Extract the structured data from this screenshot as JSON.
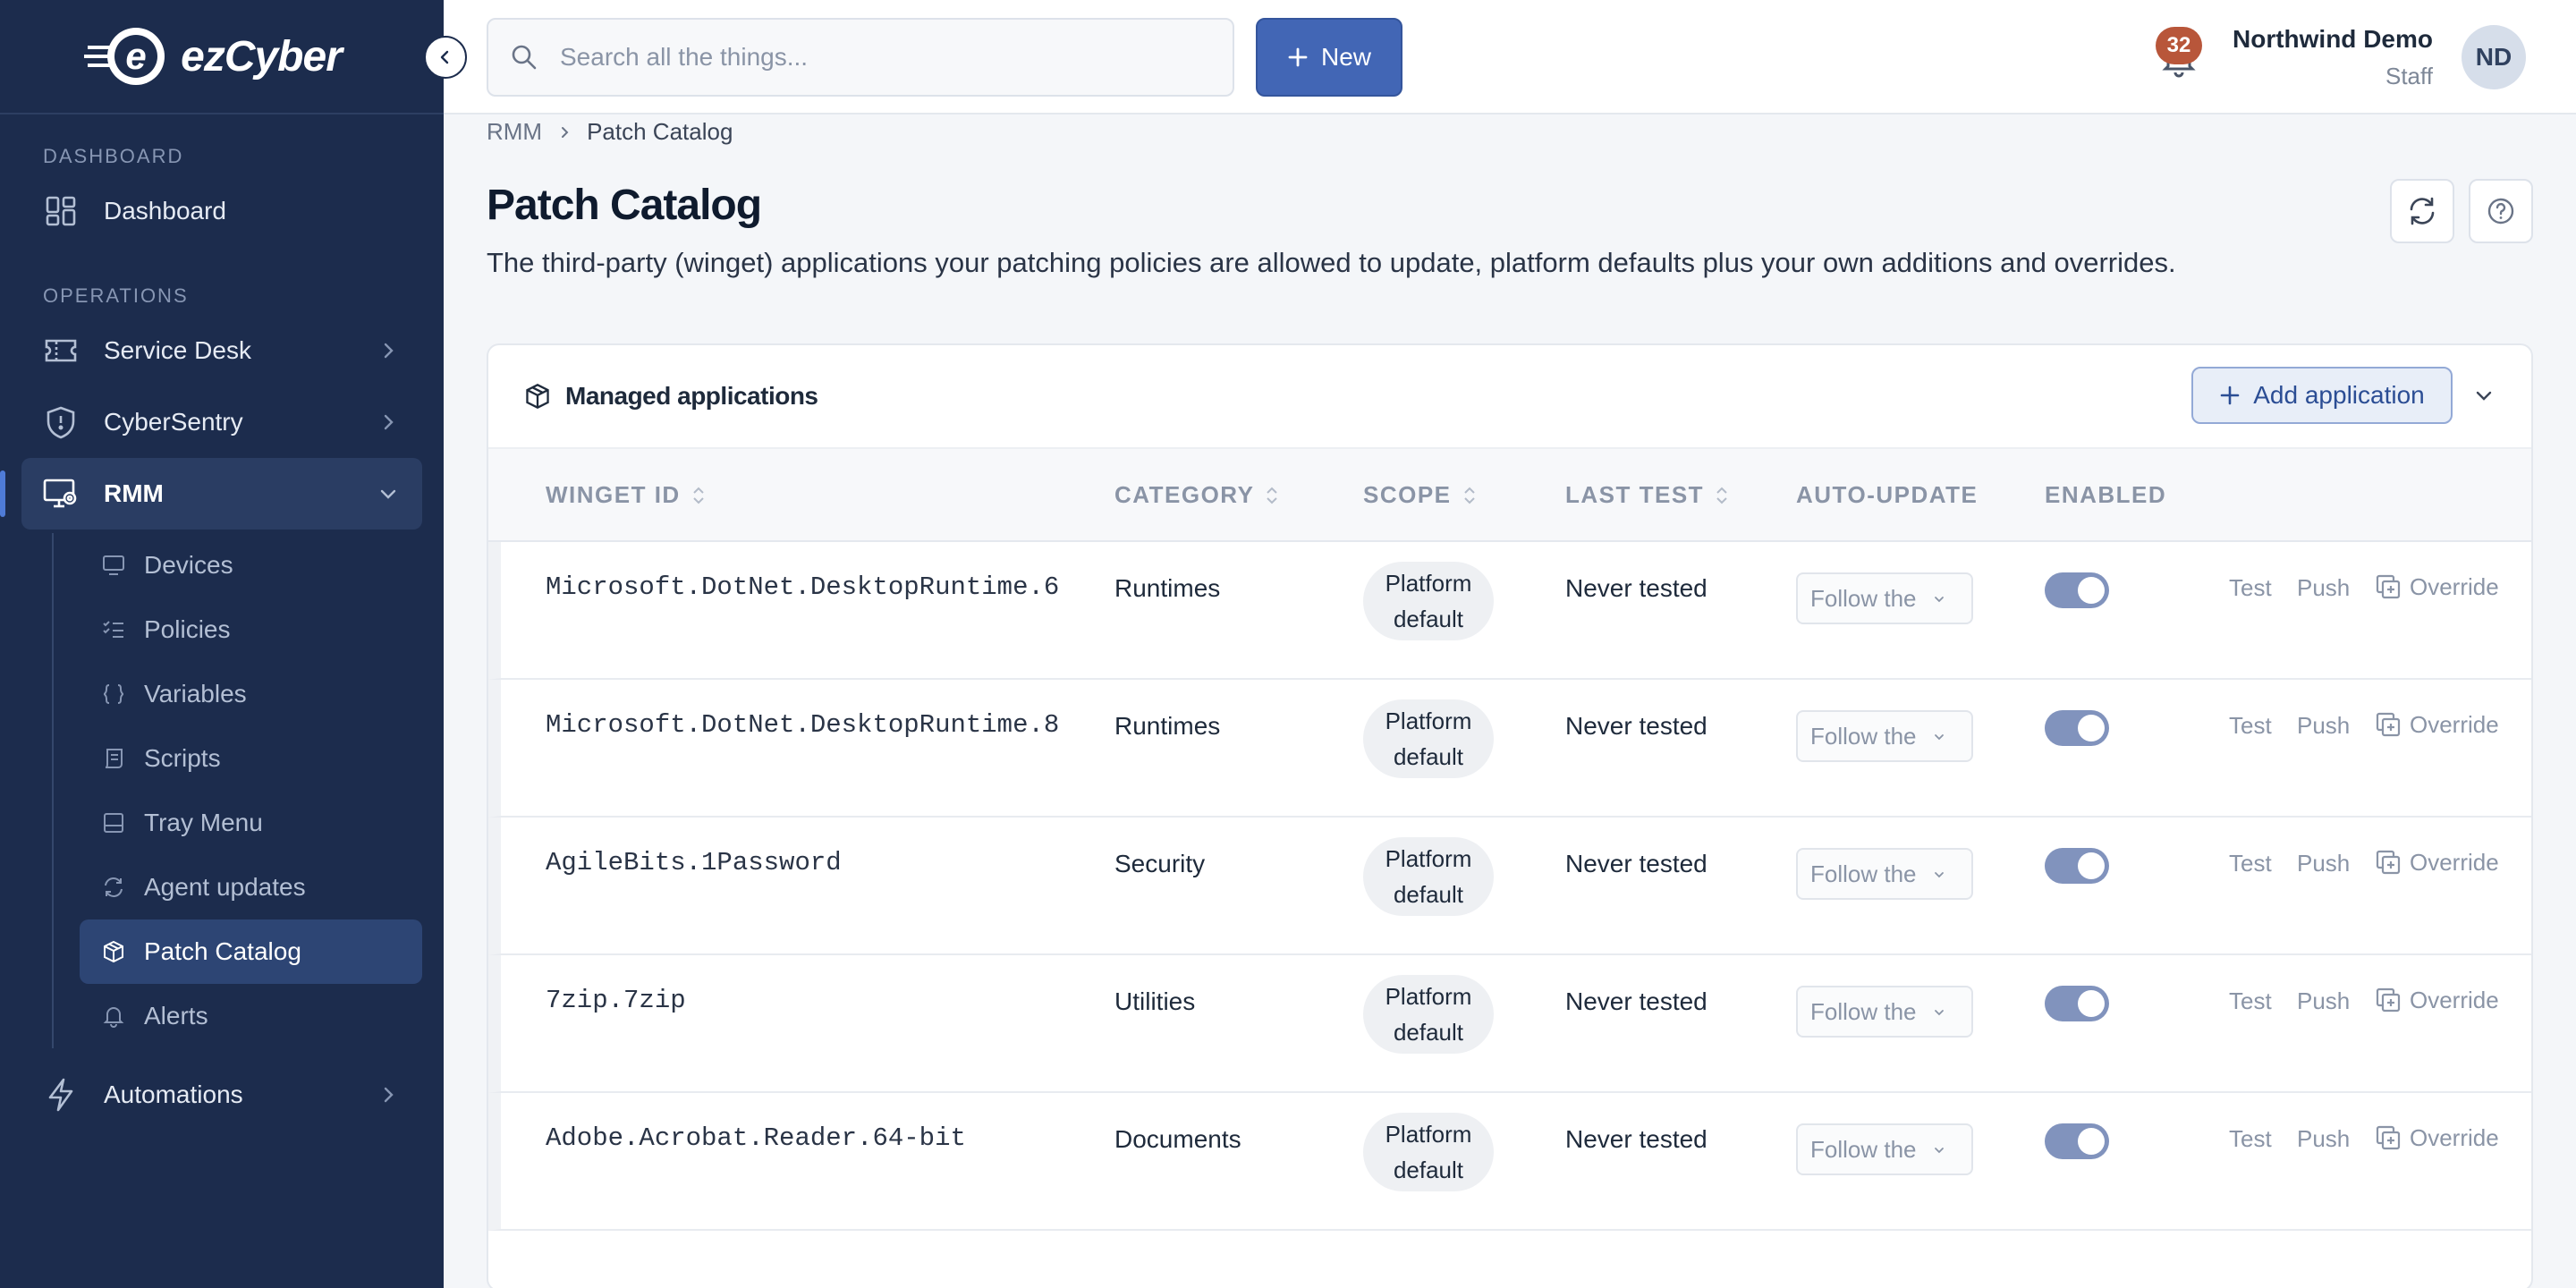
{
  "brand": {
    "name": "ezCyber"
  },
  "sidebar": {
    "section_dashboard": "DASHBOARD",
    "section_operations": "OPERATIONS",
    "dashboard": "Dashboard",
    "service_desk": "Service Desk",
    "cybersentry": "CyberSentry",
    "rmm": "RMM",
    "rmm_items": [
      "Devices",
      "Policies",
      "Variables",
      "Scripts",
      "Tray Menu",
      "Agent updates",
      "Patch Catalog",
      "Alerts"
    ],
    "automations": "Automations"
  },
  "topbar": {
    "search_placeholder": "Search all the things...",
    "new_label": "New",
    "notification_count": "32",
    "user_name": "Northwind Demo",
    "user_role": "Staff",
    "avatar_initials": "ND"
  },
  "breadcrumb": {
    "parent": "RMM",
    "current": "Patch Catalog"
  },
  "page": {
    "title": "Patch Catalog",
    "description": "The third-party (winget) applications your patching policies are allowed to update, platform defaults plus your own additions and overrides."
  },
  "card": {
    "title": "Managed applications",
    "add_label": "Add application"
  },
  "table": {
    "headers": {
      "winget_id": "WINGET ID",
      "category": "CATEGORY",
      "scope": "SCOPE",
      "last_test": "LAST TEST",
      "auto_update": "AUTO-UPDATE",
      "enabled": "ENABLED"
    },
    "rows": [
      {
        "id": "Microsoft.DotNet.DesktopRuntime.6",
        "category": "Runtimes",
        "scope_line1": "Platform",
        "scope_line2": "default",
        "last_test": "Never tested",
        "auto_update": "Follow the",
        "enabled": true
      },
      {
        "id": "Microsoft.DotNet.DesktopRuntime.8",
        "category": "Runtimes",
        "scope_line1": "Platform",
        "scope_line2": "default",
        "last_test": "Never tested",
        "auto_update": "Follow the",
        "enabled": true
      },
      {
        "id": "AgileBits.1Password",
        "category": "Security",
        "scope_line1": "Platform",
        "scope_line2": "default",
        "last_test": "Never tested",
        "auto_update": "Follow the",
        "enabled": true
      },
      {
        "id": "7zip.7zip",
        "category": "Utilities",
        "scope_line1": "Platform",
        "scope_line2": "default",
        "last_test": "Never tested",
        "auto_update": "Follow the",
        "enabled": true
      },
      {
        "id": "Adobe.Acrobat.Reader.64-bit",
        "category": "Documents",
        "scope_line1": "Platform",
        "scope_line2": "default",
        "last_test": "Never tested",
        "auto_update": "Follow the",
        "enabled": true
      }
    ],
    "actions": {
      "test": "Test",
      "push": "Push",
      "override": "Override"
    }
  },
  "colors": {
    "sidebar_bg": "#1c2c4d",
    "primary": "#4266b5",
    "badge": "#b8563a",
    "toggle_on": "#8193bd"
  }
}
